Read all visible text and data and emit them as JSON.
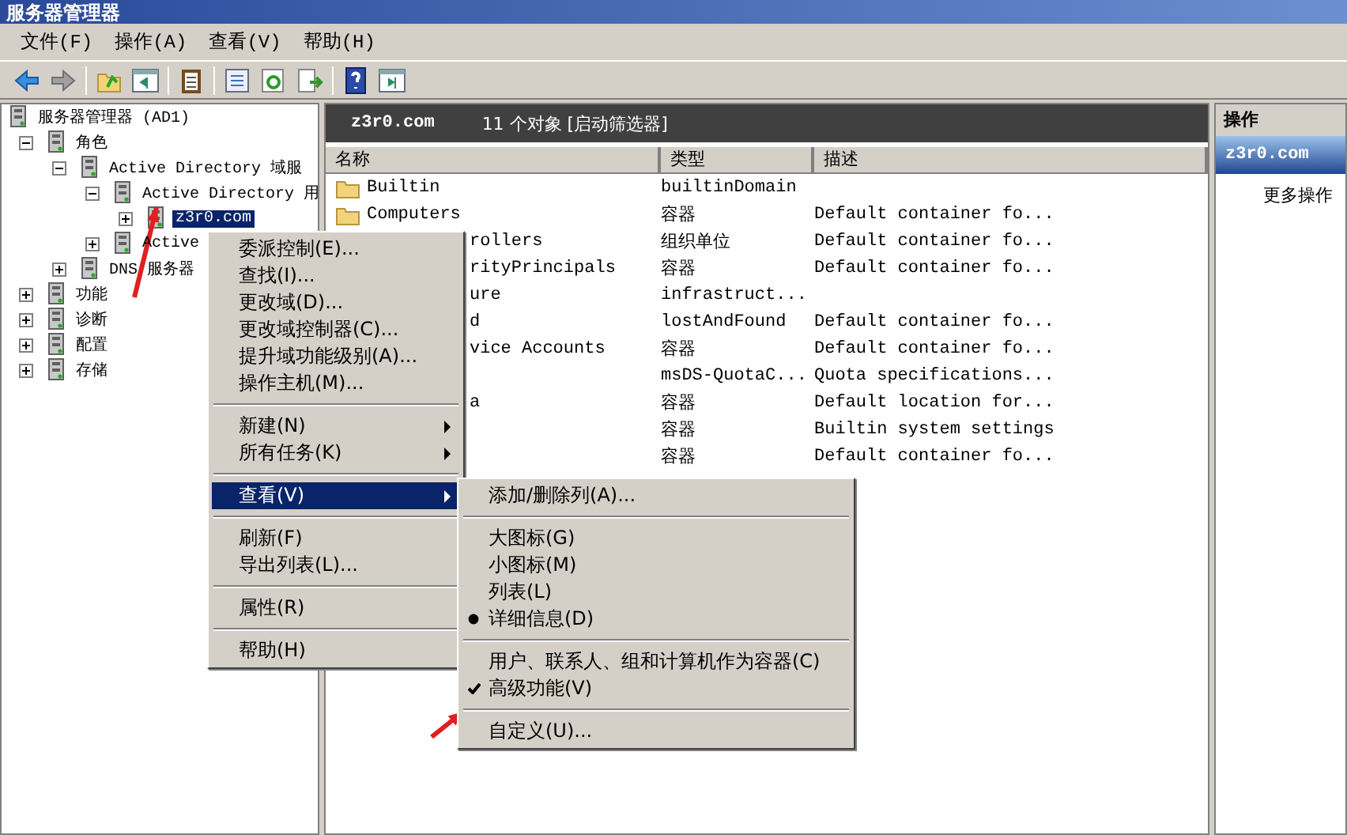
{
  "window": {
    "title": "服务器管理器"
  },
  "menubar": [
    "文件(F)",
    "操作(A)",
    "查看(V)",
    "帮助(H)"
  ],
  "tree": [
    {
      "label": "服务器管理器 (AD1)",
      "selected": false,
      "children": [
        {
          "label": "角色",
          "expanded": true,
          "selected": false,
          "children": [
            {
              "label": "Active Directory 域服",
              "expanded": true,
              "selected": false,
              "children": [
                {
                  "label": "Active Directory 用",
                  "expanded": true,
                  "selected": false,
                  "children": [
                    {
                      "label": "z3r0.com",
                      "expanded": false,
                      "selected": true
                    }
                  ]
                },
                {
                  "label": "Active",
                  "expanded": false,
                  "selected": false
                }
              ]
            },
            {
              "label": "DNS 服务器",
              "expanded": false,
              "selected": false
            }
          ]
        },
        {
          "label": "功能",
          "expanded": false,
          "selected": false
        },
        {
          "label": "诊断",
          "expanded": false,
          "selected": false
        },
        {
          "label": "配置",
          "expanded": false,
          "selected": false
        },
        {
          "label": "存储",
          "expanded": false,
          "selected": false
        }
      ]
    }
  ],
  "center": {
    "title": "z3r0.com",
    "summary": "11 个对象 [启动筛选器]",
    "columns": [
      "名称",
      "类型",
      "描述"
    ],
    "rows": [
      {
        "kind": "folder",
        "name": "Builtin",
        "type": "builtinDomain"
      },
      {
        "kind": "folder",
        "name": "Computers",
        "type": "容器",
        "description": "Default container fo..."
      },
      {
        "kind": "partial",
        "name": "rollers",
        "type": "组织单位",
        "description": "Default container fo..."
      },
      {
        "kind": "partial",
        "name": "rityPrincipals",
        "type": "容器",
        "description": "Default container fo..."
      },
      {
        "kind": "partial",
        "name": "ure",
        "type": "infrastruct..."
      },
      {
        "kind": "partial",
        "name": "d",
        "type": "lostAndFound",
        "description": "Default container fo..."
      },
      {
        "kind": "partial",
        "name": "vice Accounts",
        "type": "容器",
        "description": "Default container fo..."
      },
      {
        "kind": "partial",
        "type": "msDS-QuotaC...",
        "description": "Quota specifications..."
      },
      {
        "kind": "partial",
        "name": "a",
        "type": "容器",
        "description": "Default location for..."
      },
      {
        "kind": "partial",
        "type": "容器",
        "description": "Builtin system settings"
      },
      {
        "kind": "partial",
        "type": "容器",
        "description": "Default container fo..."
      }
    ]
  },
  "actions": {
    "title": "操作",
    "section": "z3r0.com",
    "items": [
      "更多操作"
    ]
  },
  "context_menu": {
    "groups": [
      [
        {
          "label": "委派控制(E)...",
          "submenu": false,
          "selected": false
        },
        {
          "label": "查找(I)...",
          "submenu": false,
          "selected": false
        },
        {
          "label": "更改域(D)...",
          "submenu": false,
          "selected": false
        },
        {
          "label": "更改域控制器(C)...",
          "submenu": false,
          "selected": false
        },
        {
          "label": "提升域功能级别(A)...",
          "submenu": false,
          "selected": false
        },
        {
          "label": "操作主机(M)...",
          "submenu": false,
          "selected": false
        }
      ],
      [
        {
          "label": "新建(N)",
          "submenu": true,
          "selected": false
        },
        {
          "label": "所有任务(K)",
          "submenu": true,
          "selected": false
        }
      ],
      [
        {
          "label": "查看(V)",
          "submenu": true,
          "selected": true
        }
      ],
      [
        {
          "label": "刷新(F)",
          "submenu": false,
          "selected": false
        },
        {
          "label": "导出列表(L)...",
          "submenu": false,
          "selected": false
        }
      ],
      [
        {
          "label": "属性(R)",
          "submenu": false,
          "selected": false
        }
      ],
      [
        {
          "label": "帮助(H)",
          "submenu": false,
          "selected": false
        }
      ]
    ]
  },
  "view_submenu": {
    "groups": [
      [
        {
          "kind": "command",
          "label": "添加/删除列(A)..."
        }
      ],
      [
        {
          "kind": "radio",
          "label": "大图标(G)",
          "checked": false
        },
        {
          "kind": "radio",
          "label": "小图标(M)",
          "checked": false
        },
        {
          "kind": "radio",
          "label": "列表(L)",
          "checked": false
        },
        {
          "kind": "radio",
          "label": "详细信息(D)",
          "checked": true
        }
      ],
      [
        {
          "kind": "check",
          "label": "用户、联系人、组和计算机作为容器(C)",
          "checked": false
        },
        {
          "kind": "check",
          "label": "高级功能(V)",
          "checked": true
        }
      ],
      [
        {
          "kind": "command",
          "label": "自定义(U)..."
        }
      ]
    ]
  }
}
